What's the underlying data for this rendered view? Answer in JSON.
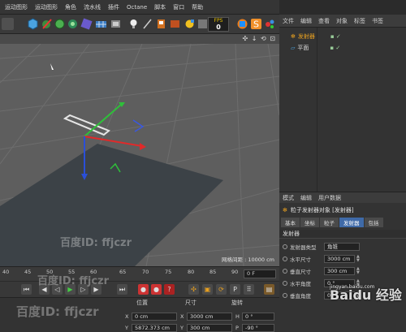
{
  "menu": {
    "items": [
      "运动图形",
      "运动图形",
      "角色",
      "流水线",
      "插件",
      "Octane",
      "脚本",
      "窗口",
      "帮助"
    ]
  },
  "toolbar": {
    "fps_label": "FPS",
    "fps_value": "0"
  },
  "viewport": {
    "grid_spacing": "网格间距 : 10000 cm",
    "nav_icons": "✣ ↓ ⟲ ⊡"
  },
  "object_manager": {
    "tabs": [
      "文件",
      "编辑",
      "查看",
      "对象",
      "标签",
      "书签"
    ],
    "objects": [
      {
        "name": "发射器",
        "selected": true
      },
      {
        "name": "平面",
        "selected": false
      }
    ]
  },
  "attribute_manager": {
    "tabs": [
      "模式",
      "编辑",
      "用户数据"
    ],
    "title": "粒子发射器对象 [发射器]",
    "subtabs": [
      "基本",
      "坐标",
      "粒子",
      "发射器",
      "包括"
    ],
    "active_subtab": "发射器",
    "section": "发射器",
    "fields": [
      {
        "label": "发射器类型",
        "value": "角锥"
      },
      {
        "label": "水平尺寸",
        "value": "3000 cm"
      },
      {
        "label": "垂直尺寸",
        "value": "300 cm"
      },
      {
        "label": "水平角度",
        "value": "0 °"
      },
      {
        "label": "垂直角度",
        "value": "0 °"
      }
    ]
  },
  "timeline": {
    "ticks": [
      "40",
      "45",
      "50",
      "55",
      "60",
      "65",
      "70",
      "75",
      "80",
      "85",
      "90"
    ],
    "current_frame": "0 F"
  },
  "coordinates": {
    "headers": [
      "位置",
      "尺寸",
      "旋转"
    ],
    "rows": [
      {
        "pos_axis": "X",
        "pos": "0 cm",
        "size_axis": "X",
        "size": "3000 cm",
        "rot_axis": "H",
        "rot": "0 °"
      },
      {
        "pos_axis": "Y",
        "pos": "5872.373 cm",
        "size_axis": "Y",
        "size": "300 cm",
        "rot_axis": "P",
        "rot": "-90 °"
      }
    ]
  },
  "watermarks": {
    "baidu_id": "百度ID: ffjczr",
    "baidu_logo": "Baidu 经验",
    "baidu_url": "jingyan.baidu.com"
  },
  "colors": {
    "accent_blue": "#3f6aa8",
    "axis_red": "#e03030",
    "axis_green": "#30c040",
    "axis_blue": "#3050e0",
    "selection_orange": "#e8a020"
  }
}
